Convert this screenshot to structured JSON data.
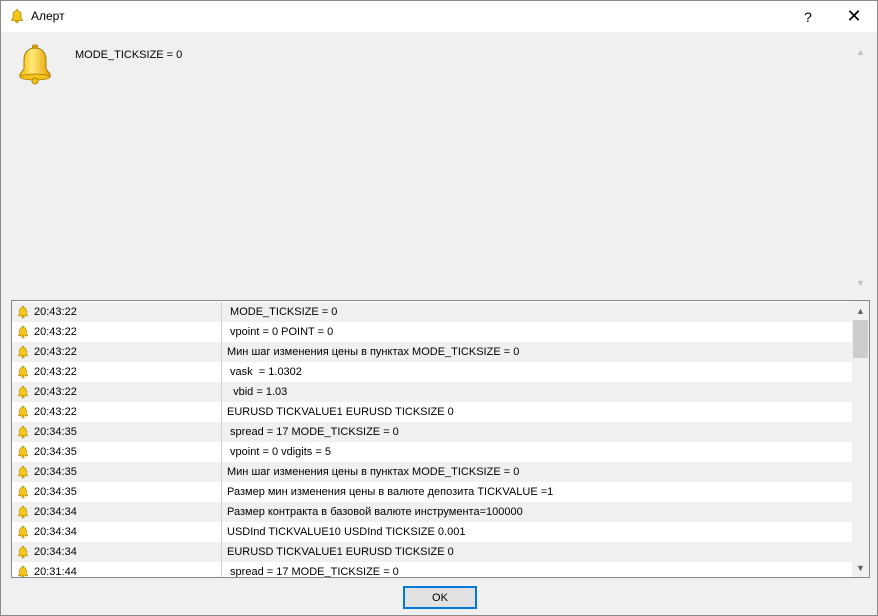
{
  "window": {
    "title": "Алерт",
    "help_label": "?",
    "close_label": "✕"
  },
  "message": {
    "text": "MODE_TICKSIZE = 0"
  },
  "scroll_arrows": {
    "up": "▲",
    "down": "▼"
  },
  "log": {
    "rows": [
      {
        "time": "20:43:22",
        "message": " MODE_TICKSIZE = 0"
      },
      {
        "time": "20:43:22",
        "message": " vpoint = 0 POINT = 0"
      },
      {
        "time": "20:43:22",
        "message": "Мин шаг изменения цены в пунктах MODE_TICKSIZE = 0"
      },
      {
        "time": "20:43:22",
        "message": " vask  = 1.0302"
      },
      {
        "time": "20:43:22",
        "message": "  vbid = 1.03"
      },
      {
        "time": "20:43:22",
        "message": "EURUSD TICKVALUE1 EURUSD TICKSIZE 0"
      },
      {
        "time": "20:34:35",
        "message": " spread = 17 MODE_TICKSIZE = 0"
      },
      {
        "time": "20:34:35",
        "message": " vpoint = 0 vdigits = 5"
      },
      {
        "time": "20:34:35",
        "message": "Мин шаг изменения цены в пунктах MODE_TICKSIZE = 0"
      },
      {
        "time": "20:34:35",
        "message": "Размер мин изменения цены в валюте депозита TICKVALUE =1"
      },
      {
        "time": "20:34:34",
        "message": "Размер контракта в базовой валюте инструмента=100000"
      },
      {
        "time": "20:34:34",
        "message": "USDInd TICKVALUE10 USDInd TICKSIZE 0.001"
      },
      {
        "time": "20:34:34",
        "message": "EURUSD TICKVALUE1 EURUSD TICKSIZE 0"
      },
      {
        "time": "20:31:44",
        "message": " spread = 17 MODE_TICKSIZE = 0"
      }
    ]
  },
  "buttons": {
    "ok_label": "OK"
  }
}
